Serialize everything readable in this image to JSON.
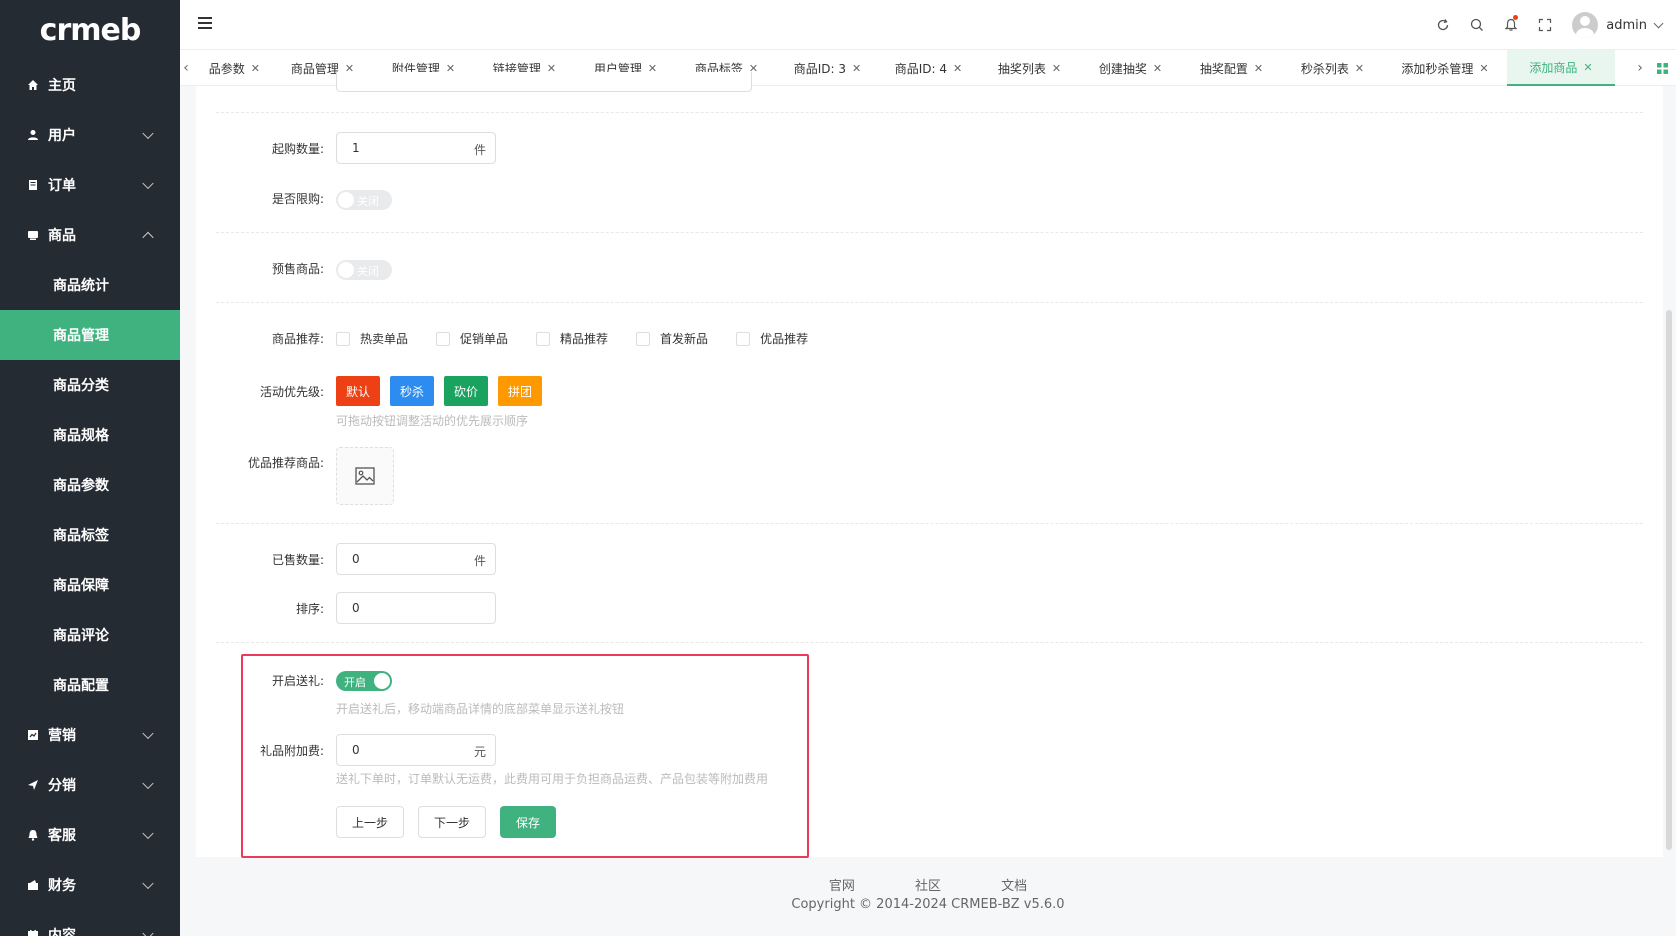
{
  "brand": {
    "logo_text": "crmeb"
  },
  "sidebar": {
    "items": [
      {
        "label": "主页",
        "icon": "home-icon",
        "expandable": false
      },
      {
        "label": "用户",
        "icon": "user-icon",
        "expandable": true
      },
      {
        "label": "订单",
        "icon": "order-icon",
        "expandable": true
      },
      {
        "label": "商品",
        "icon": "product-icon",
        "expandable": true,
        "expanded": true
      },
      {
        "label": "营销",
        "icon": "marketing-icon",
        "expandable": true
      },
      {
        "label": "分销",
        "icon": "distribution-icon",
        "expandable": true
      },
      {
        "label": "客服",
        "icon": "service-icon",
        "expandable": true
      },
      {
        "label": "财务",
        "icon": "finance-icon",
        "expandable": true
      },
      {
        "label": "内容",
        "icon": "content-icon",
        "expandable": true
      }
    ],
    "product_sub_items": [
      {
        "label": "商品统计"
      },
      {
        "label": "商品管理",
        "active": true
      },
      {
        "label": "商品分类"
      },
      {
        "label": "商品规格"
      },
      {
        "label": "商品参数"
      },
      {
        "label": "商品标签"
      },
      {
        "label": "商品保障"
      },
      {
        "label": "商品评论"
      },
      {
        "label": "商品配置"
      }
    ]
  },
  "header": {
    "username": "admin",
    "icons": [
      "refresh-icon",
      "search-icon",
      "bell-icon",
      "fullscreen-icon"
    ]
  },
  "tabs": [
    {
      "label": "品参数"
    },
    {
      "label": "商品管理"
    },
    {
      "label": "附件管理"
    },
    {
      "label": "链接管理"
    },
    {
      "label": "用户管理"
    },
    {
      "label": "商品标签"
    },
    {
      "label": "商品ID: 3"
    },
    {
      "label": "商品ID: 4"
    },
    {
      "label": "抽奖列表"
    },
    {
      "label": "创建抽奖"
    },
    {
      "label": "抽奖配置"
    },
    {
      "label": "秒杀列表"
    },
    {
      "label": "添加秒杀管理"
    },
    {
      "label": "添加商品",
      "active": true
    }
  ],
  "form": {
    "min_purchase": {
      "label": "起购数量:",
      "value": "1",
      "suffix": "件"
    },
    "purchase_limit": {
      "label": "是否限购:",
      "toggle": "关闭",
      "on": false
    },
    "presale": {
      "label": "预售商品:",
      "toggle": "关闭",
      "on": false
    },
    "recommend": {
      "label": "商品推荐:",
      "options": [
        "热卖单品",
        "促销单品",
        "精品推荐",
        "首发新品",
        "优品推荐"
      ]
    },
    "activity_priority": {
      "label": "活动优先级:",
      "buttons": [
        {
          "label": "默认",
          "color": "#ed4014"
        },
        {
          "label": "秒杀",
          "color": "#2d8cf0"
        },
        {
          "label": "砍价",
          "color": "#19a35f"
        },
        {
          "label": "拼团",
          "color": "#ff9900"
        }
      ],
      "hint": "可拖动按钮调整活动的优先展示顺序"
    },
    "recommended_products": {
      "label": "优品推荐商品:"
    },
    "sold_count": {
      "label": "已售数量:",
      "value": "0",
      "suffix": "件"
    },
    "sort": {
      "label": "排序:",
      "value": "0"
    },
    "gift_enable": {
      "label": "开启送礼:",
      "toggle": "开启",
      "on": true,
      "hint": "开启送礼后，移动端商品详情的底部菜单显示送礼按钮"
    },
    "gift_fee": {
      "label": "礼品附加费:",
      "value": "0",
      "suffix": "元",
      "hint": "送礼下单时，订单默认无运费，此费用可用于负担商品运费、产品包装等附加费用"
    },
    "buttons": {
      "prev": "上一步",
      "next": "下一步",
      "save": "保存"
    }
  },
  "footer": {
    "links": [
      "官网",
      "社区",
      "文档"
    ],
    "copyright": "Copyright © 2014-2024 CRMEB-BZ v5.6.0"
  },
  "colors": {
    "accent": "#3fb27f",
    "sidebar_bg": "#252b33",
    "highlight": "#ed3a5a"
  }
}
